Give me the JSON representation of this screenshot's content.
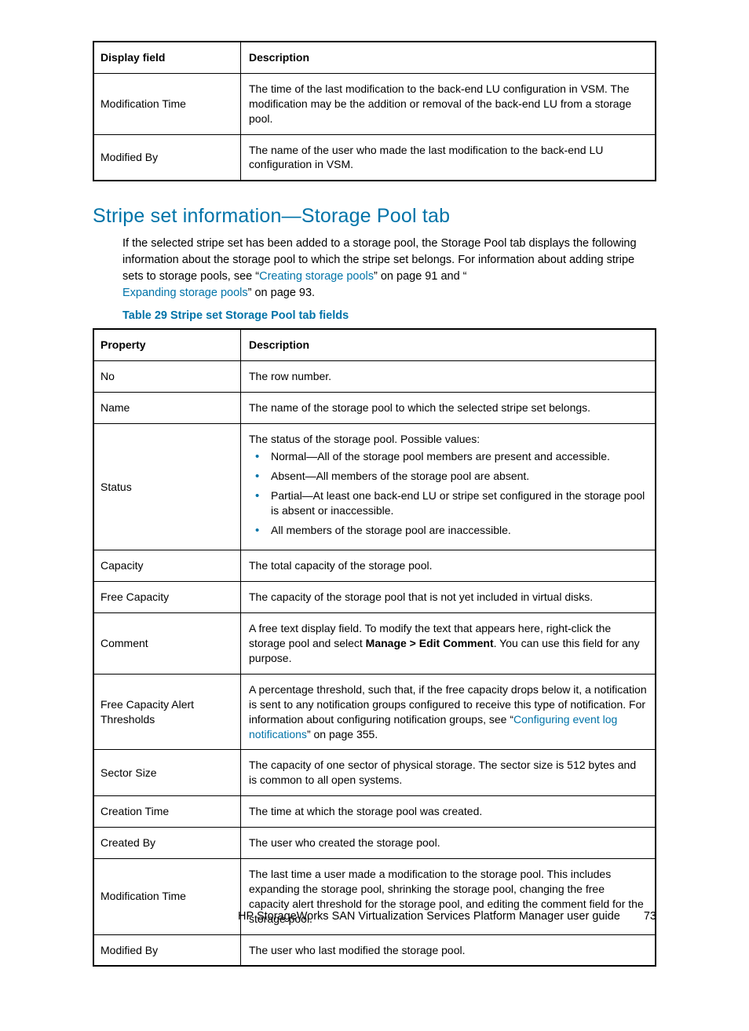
{
  "table1": {
    "headers": {
      "c1": "Display field",
      "c2": "Description"
    },
    "rows": [
      {
        "c1": "Modification Time",
        "c2": "The time of the last modification to the back-end LU configuration in VSM. The modification may be the addition or removal of the back-end LU from a storage pool."
      },
      {
        "c1": "Modified By",
        "c2": "The name of the user who made the last modification to the back-end LU configuration in VSM."
      }
    ]
  },
  "section": {
    "heading": "Stripe set information—Storage Pool tab",
    "para_pre": "If the selected stripe set has been added to a storage pool, the Storage Pool tab displays the following information about the storage pool to which the stripe set belongs. For information about adding stripe sets to storage pools, see “",
    "link1": "Creating storage pools",
    "para_mid1": "” on page 91 and “",
    "link2": "Expanding storage pools",
    "para_mid2": "” on page 93."
  },
  "caption": "Table 29 Stripe set Storage Pool tab fields",
  "table2": {
    "headers": {
      "c1": "Property",
      "c2": "Description"
    },
    "rows": {
      "no": {
        "c1": "No",
        "c2": "The row number."
      },
      "name": {
        "c1": "Name",
        "c2": "The name of the storage pool to which the selected stripe set belongs."
      },
      "status": {
        "c1": "Status",
        "intro": "The status of the storage pool. Possible values:",
        "b1": "Normal—All of the storage pool members are present and accessible.",
        "b2": "Absent—All members of the storage pool are absent.",
        "b3": "Partial—At least one back-end LU or stripe set configured in the storage pool is absent or inaccessible.",
        "b4": "All members of the storage pool are inaccessible."
      },
      "capacity": {
        "c1": "Capacity",
        "c2": "The total capacity of the storage pool."
      },
      "freecap": {
        "c1": "Free Capacity",
        "c2": "The capacity of the storage pool that is not yet included in virtual disks."
      },
      "comment": {
        "c1": "Comment",
        "pre": "A free text display field. To modify the text that appears here, right-click the storage pool and select ",
        "bold": "Manage > Edit Comment",
        "post": ". You can use this field for any purpose."
      },
      "fcat": {
        "c1": "Free Capacity Alert Thresholds",
        "pre": "A percentage threshold, such that, if the free capacity drops below it, a notification is sent to any notification groups configured to receive this type of notification. For information about configuring notification groups, see “",
        "link": "Configuring event log notifications",
        "post": "” on page 355."
      },
      "sector": {
        "c1": "Sector Size",
        "c2": "The capacity of one sector of physical storage. The sector size is 512 bytes and is common to all open systems."
      },
      "ctime": {
        "c1": "Creation Time",
        "c2": "The time at which the storage pool was created."
      },
      "cby": {
        "c1": "Created By",
        "c2": "The user who created the storage pool."
      },
      "mtime": {
        "c1": "Modification Time",
        "c2": "The last time a user made a modification to the storage pool. This includes expanding the storage pool, shrinking the storage pool, changing the free capacity alert threshold for the storage pool, and editing the comment field for the storage pool."
      },
      "mby": {
        "c1": "Modified By",
        "c2": "The user who last modified the storage pool."
      }
    }
  },
  "footer": {
    "title": "HP StorageWorks SAN Virtualization Services Platform Manager user guide",
    "page": "73"
  }
}
